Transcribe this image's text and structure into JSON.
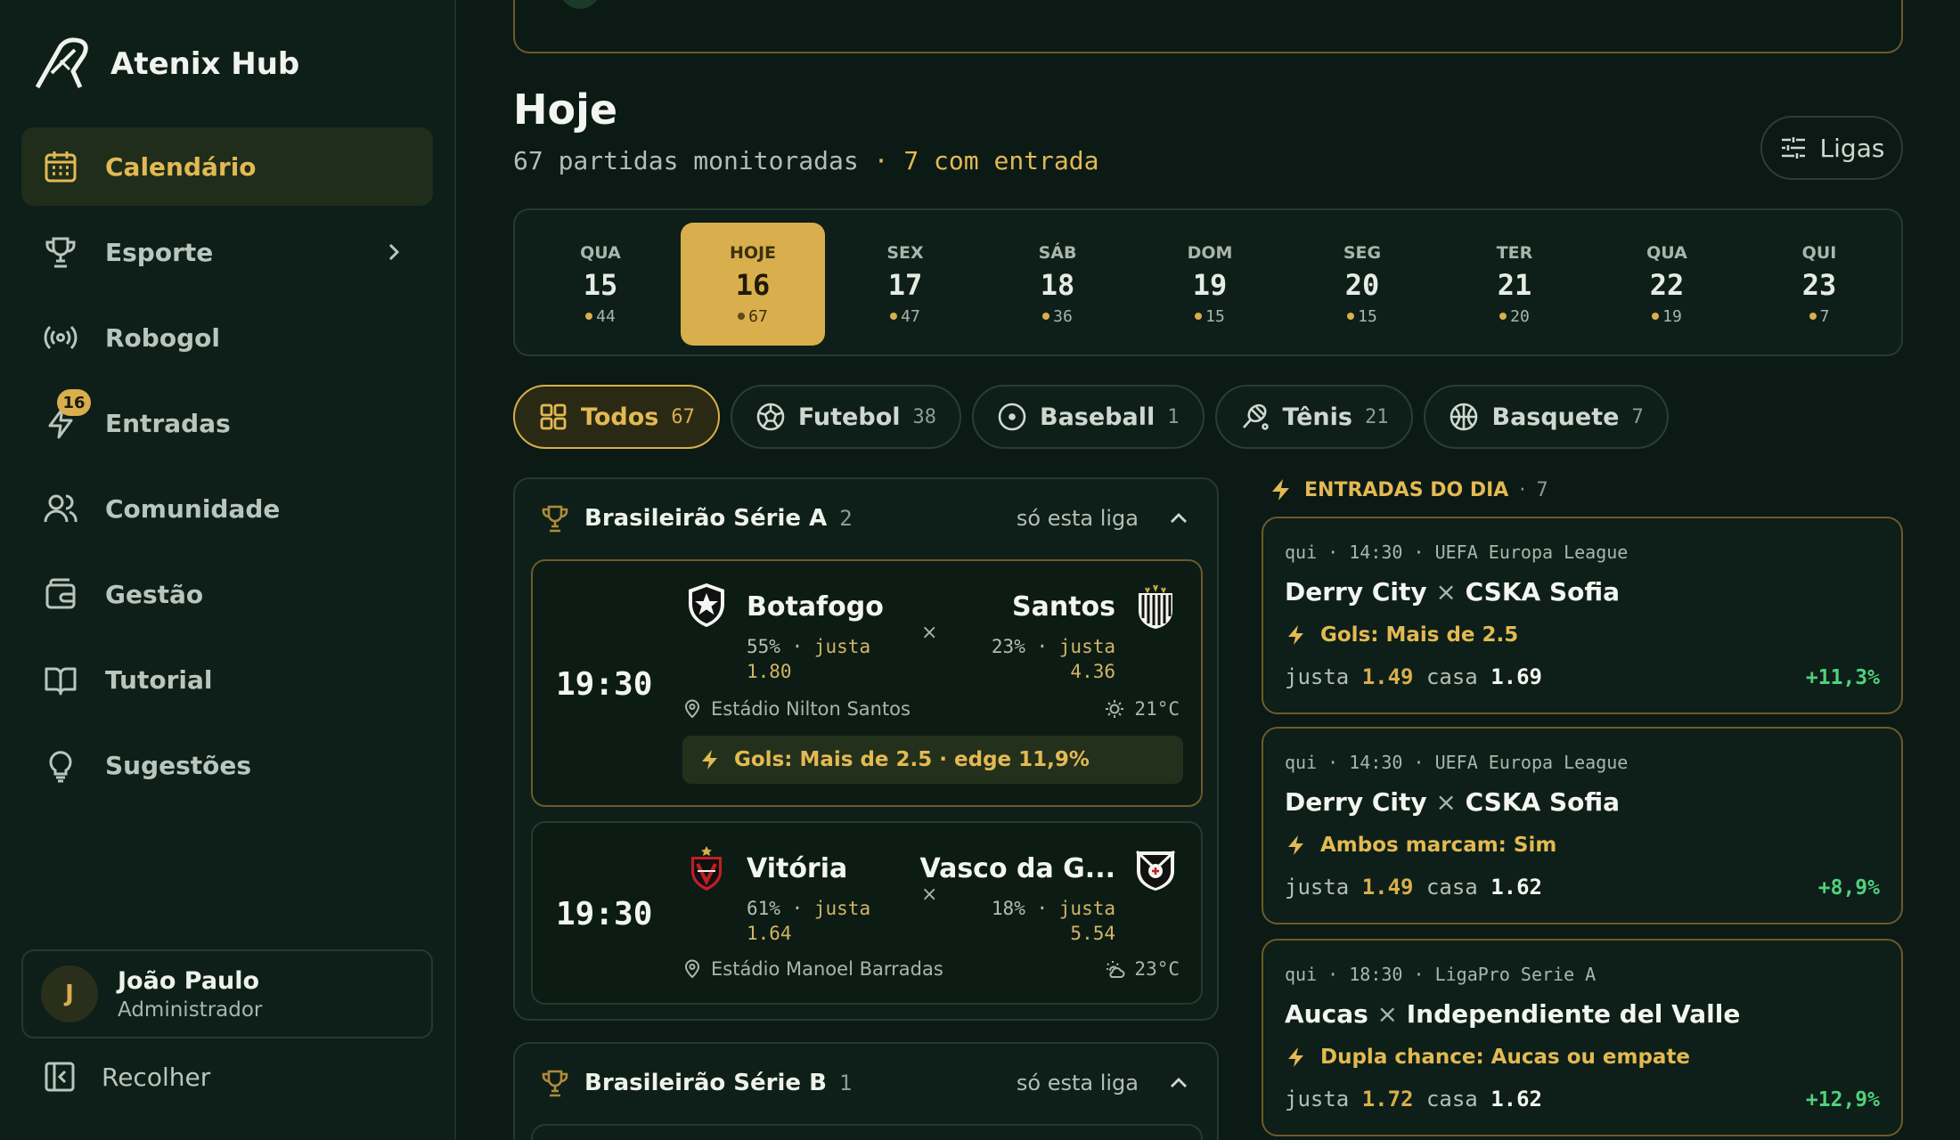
{
  "brand": {
    "name": "Atenix Hub"
  },
  "nav": [
    {
      "label": "Calendário",
      "icon": "calendar-icon",
      "active": true
    },
    {
      "label": "Esporte",
      "icon": "trophy-icon",
      "chevron": true
    },
    {
      "label": "Robogol",
      "icon": "broadcast-icon"
    },
    {
      "label": "Entradas",
      "icon": "bolt-icon",
      "badge": "16"
    },
    {
      "label": "Comunidade",
      "icon": "users-icon"
    },
    {
      "label": "Gestão",
      "icon": "wallet-icon"
    },
    {
      "label": "Tutorial",
      "icon": "book-icon"
    },
    {
      "label": "Sugestões",
      "icon": "lightbulb-icon"
    }
  ],
  "user": {
    "initial": "J",
    "name": "João Paulo",
    "role": "Administrador"
  },
  "collapse_label": "Recolher",
  "header": {
    "title": "Hoje",
    "subtitle_main": "67 partidas monitoradas",
    "subtitle_sep": " · ",
    "subtitle_hl": "7 com entrada",
    "ligas_label": "Ligas"
  },
  "dates": [
    {
      "dow": "QUA",
      "num": "15",
      "count": "44"
    },
    {
      "dow": "HOJE",
      "num": "16",
      "count": "67",
      "active": true
    },
    {
      "dow": "SEX",
      "num": "17",
      "count": "47"
    },
    {
      "dow": "SÁB",
      "num": "18",
      "count": "36"
    },
    {
      "dow": "DOM",
      "num": "19",
      "count": "15"
    },
    {
      "dow": "SEG",
      "num": "20",
      "count": "15"
    },
    {
      "dow": "TER",
      "num": "21",
      "count": "20"
    },
    {
      "dow": "QUA",
      "num": "22",
      "count": "19"
    },
    {
      "dow": "QUI",
      "num": "23",
      "count": "7"
    }
  ],
  "filters": [
    {
      "label": "Todos",
      "count": "67",
      "active": true
    },
    {
      "label": "Futebol",
      "count": "38"
    },
    {
      "label": "Baseball",
      "count": "1"
    },
    {
      "label": "Tênis",
      "count": "21"
    },
    {
      "label": "Basquete",
      "count": "7"
    }
  ],
  "leagues": [
    {
      "name": "Brasileirão Série A",
      "count": "2",
      "only_label": "só esta liga",
      "matches": [
        {
          "time": "19:30",
          "home": {
            "name": "Botafogo",
            "pct": "55%",
            "fair_label": "justa",
            "fair": "1.80"
          },
          "away": {
            "name": "Santos",
            "pct": "23%",
            "fair_label": "justa",
            "fair": "4.36"
          },
          "vs": "×",
          "venue": "Estádio Nilton Santos",
          "weather": "21°C",
          "pick": "Gols: Mais de 2.5 · edge 11,9%"
        },
        {
          "time": "19:30",
          "home": {
            "name": "Vitória",
            "pct": "61%",
            "fair_label": "justa",
            "fair": "1.64"
          },
          "away": {
            "name": "Vasco da G...",
            "pct": "18%",
            "fair_label": "justa",
            "fair": "5.54"
          },
          "vs": "×",
          "venue": "Estádio Manoel Barradas",
          "weather": "23°C"
        }
      ]
    },
    {
      "name": "Brasileirão Série B",
      "count": "1",
      "only_label": "só esta liga"
    }
  ],
  "entries": {
    "title": "ENTRADAS DO DIA",
    "sep": "·",
    "count": "7",
    "items": [
      {
        "meta": "qui · 14:30 · UEFA Europa League",
        "home": "Derry City",
        "away": "CSKA Sofia",
        "x": "×",
        "pick": "Gols: Mais de 2.5",
        "fair_label": "justa",
        "fair": "1.49",
        "house_label": "casa",
        "house": "1.69",
        "edge": "+11,3%"
      },
      {
        "meta": "qui · 14:30 · UEFA Europa League",
        "home": "Derry City",
        "away": "CSKA Sofia",
        "x": "×",
        "pick": "Ambos marcam: Sim",
        "fair_label": "justa",
        "fair": "1.49",
        "house_label": "casa",
        "house": "1.62",
        "edge": "+8,9%"
      },
      {
        "meta": "qui · 18:30 · LigaPro Serie A",
        "home": "Aucas",
        "away": "Independiente del Valle",
        "x": "×",
        "pick": "Dupla chance: Aucas ou empate",
        "fair_label": "justa",
        "fair": "1.72",
        "house_label": "casa",
        "house": "1.62",
        "edge": "+12,9%"
      }
    ]
  },
  "colors": {
    "accent": "#d9ae4c",
    "bg": "#0b1a14",
    "positive": "#4fd17d"
  }
}
